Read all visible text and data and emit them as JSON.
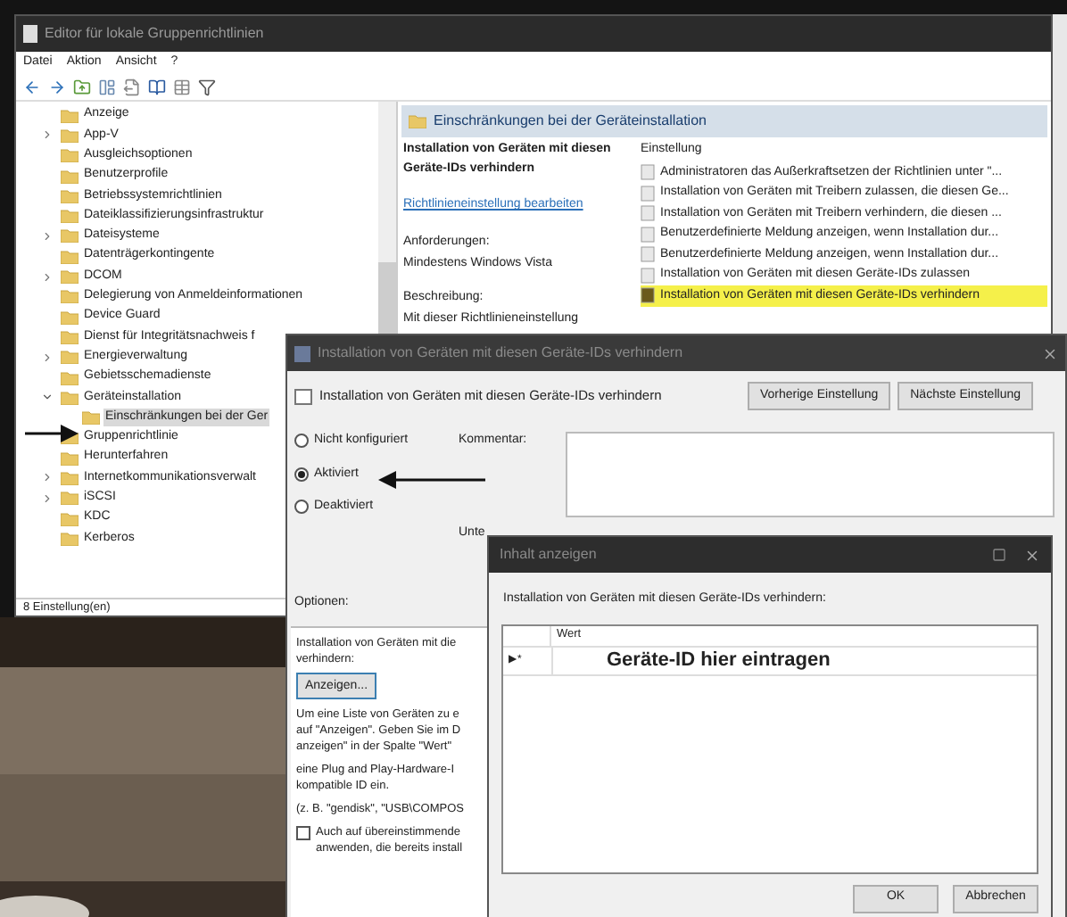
{
  "main_window": {
    "title": "Editor für lokale Gruppenrichtlinien",
    "menu": [
      "Datei",
      "Aktion",
      "Ansicht",
      "?"
    ],
    "tree": [
      {
        "label": "Anzeige",
        "selected": false
      },
      {
        "label": "App-V",
        "expanded": false,
        "selected": false
      },
      {
        "label": "Ausgleichsoptionen",
        "selected": false
      },
      {
        "label": "Benutzerprofile",
        "selected": false
      },
      {
        "label": "Betriebssystemrichtlinien",
        "selected": false
      },
      {
        "label": "Dateiklassifizierungsinfrastruktur",
        "selected": false
      },
      {
        "label": "Dateisysteme",
        "expanded": false,
        "selected": false
      },
      {
        "label": "Datenträgerkontingente",
        "selected": false
      },
      {
        "label": "DCOM",
        "expanded": false,
        "selected": false
      },
      {
        "label": "Delegierung von Anmeldeinformationen",
        "selected": false
      },
      {
        "label": "Device Guard",
        "selected": false
      },
      {
        "label": "Dienst für Integritätsnachweis f",
        "selected": false
      },
      {
        "label": "Energieverwaltung",
        "expanded": false,
        "selected": false
      },
      {
        "label": "Gebietsschemadienste",
        "selected": false
      },
      {
        "label": "Geräteinstallation",
        "expanded": true,
        "selected": false,
        "children": [
          {
            "label": "Einschränkungen bei der Ger",
            "selected": true
          }
        ]
      },
      {
        "label": "Gruppenrichtlinie",
        "selected": false
      },
      {
        "label": "Herunterfahren",
        "selected": false
      },
      {
        "label": "Internetkommunikationsverwalt",
        "expanded": false,
        "selected": false
      },
      {
        "label": "iSCSI",
        "expanded": false,
        "selected": false
      },
      {
        "label": "KDC",
        "selected": false
      },
      {
        "label": "Kerberos",
        "selected": false
      }
    ],
    "header": "Einschränkungen bei der Geräteinstallation",
    "description": {
      "title": "Installation von Geräten mit diesen Geräte-IDs verhindern",
      "link": "Richtlinieneinstellung bearbeiten",
      "requirements_label": "Anforderungen:",
      "requirements": "Mindestens Windows Vista",
      "description_label": "Beschreibung:",
      "description": "Mit dieser Richtlinieneinstellung"
    },
    "settings": {
      "column": "Einstellung",
      "items": [
        {
          "label": "Administratoren das Außerkraftsetzen der Richtlinien unter \"...",
          "selected": false
        },
        {
          "label": "Installation von Geräten mit Treibern zulassen, die diesen Ge...",
          "selected": false
        },
        {
          "label": "Installation von Geräten mit Treibern verhindern, die diesen ...",
          "selected": false
        },
        {
          "label": "Benutzerdefinierte Meldung anzeigen, wenn Installation dur...",
          "selected": false
        },
        {
          "label": "Benutzerdefinierte Meldung anzeigen, wenn Installation dur...",
          "selected": false
        },
        {
          "label": "Installation von Geräten mit diesen Geräte-IDs zulassen",
          "selected": false
        },
        {
          "label": "Installation von Geräten mit diesen Geräte-IDs verhindern",
          "selected": true
        }
      ]
    },
    "status_bar": "8 Einstellung(en)"
  },
  "policy_dialog": {
    "title": "Installation von Geräten mit diesen Geräte-IDs verhindern",
    "heading": "Installation von Geräten mit diesen Geräte-IDs verhindern",
    "buttons": [
      "Vorherige Einstellung",
      "Nächste Einstellung"
    ],
    "states": [
      {
        "label": "Nicht konfiguriert",
        "selected": false
      },
      {
        "label": "Aktiviert",
        "selected": true
      },
      {
        "label": "Deaktiviert",
        "selected": false
      }
    ],
    "comment_label": "Kommentar:",
    "supported_label": "Unte",
    "options_label": "Optionen:",
    "options": {
      "prompt_lines": [
        "Installation von Geräten mit die",
        "verhindern:"
      ],
      "show_button": "Anzeigen...",
      "help": [
        [
          "Um eine Liste von Geräten zu e",
          "auf \"Anzeigen\". Geben Sie im D",
          "anzeigen\" in der Spalte \"Wert\""
        ],
        [
          "eine Plug and Play-Hardware-I",
          "kompatible ID ein."
        ],
        [
          "(z. B. \"gendisk\", \"USB\\COMPOS"
        ]
      ],
      "checkbox": {
        "lines": [
          "Auch auf übereinstimmende",
          "anwenden, die bereits install"
        ],
        "checked": false
      }
    }
  },
  "content_dialog": {
    "title": "Inhalt anzeigen",
    "prompt": "Installation von Geräten mit diesen Geräte-IDs verhindern:",
    "column": "Wert",
    "rows": [
      {
        "marker": "▶*",
        "value": "Geräte-ID hier eintragen"
      }
    ],
    "buttons": [
      "OK",
      "Abbrechen"
    ]
  }
}
